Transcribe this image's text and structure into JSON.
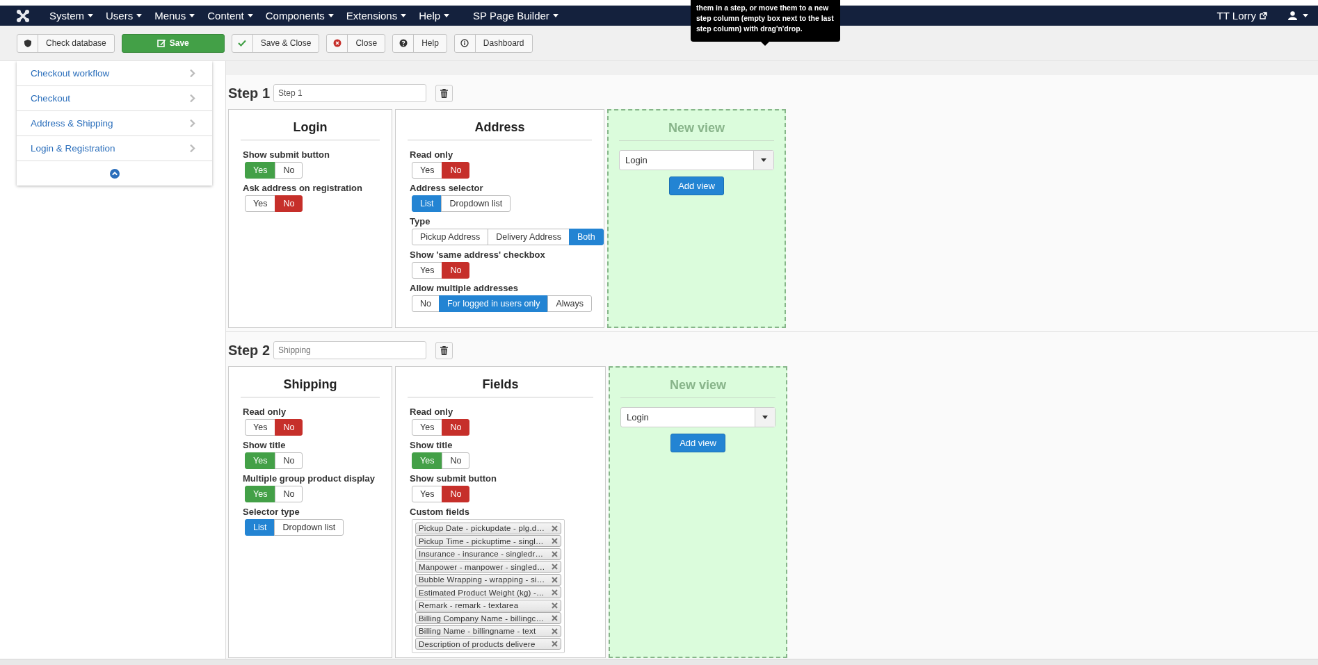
{
  "navbar": {
    "menus": [
      "System",
      "Users",
      "Menus",
      "Content",
      "Components",
      "Extensions",
      "Help",
      "SP Page Builder"
    ],
    "site_link": "TT Lorry"
  },
  "tooltip": {
    "text": "them in a step, or move them to a new step column (empty box next to the last step column) with drag'n'drop."
  },
  "toolbar": {
    "buttons": [
      {
        "label": "Check database",
        "kind": "shield"
      },
      {
        "label": "Save",
        "kind": "save"
      },
      {
        "label": "Save & Close",
        "kind": "check"
      },
      {
        "label": "Close",
        "kind": "close"
      },
      {
        "label": "Help",
        "kind": "help"
      },
      {
        "label": "Dashboard",
        "kind": "info"
      }
    ]
  },
  "sidebar": {
    "items": [
      "Checkout workflow",
      "Checkout",
      "Address & Shipping",
      "Login & Registration"
    ]
  },
  "steps": [
    {
      "title": "Step 1",
      "input": {
        "value": "Step 1"
      },
      "views": [
        {
          "title": "Login",
          "options": [
            {
              "label": "Show submit button",
              "choices": [
                {
                  "label": "Yes",
                  "selected": true,
                  "color": "#43a047"
                },
                {
                  "label": "No",
                  "selected": false
                }
              ]
            },
            {
              "label": "Ask address on registration",
              "choices": [
                {
                  "label": "Yes",
                  "selected": false
                },
                {
                  "label": "No",
                  "selected": true,
                  "color": "#c62f2a"
                }
              ]
            }
          ]
        },
        {
          "title": "Address",
          "options": [
            {
              "label": "Read only",
              "choices": [
                {
                  "label": "Yes",
                  "selected": false
                },
                {
                  "label": "No",
                  "selected": true,
                  "color": "#c62f2a"
                }
              ]
            },
            {
              "label": "Address selector",
              "choices": [
                {
                  "label": "List",
                  "selected": true,
                  "color": "#2384d3"
                },
                {
                  "label": "Dropdown list",
                  "selected": false
                }
              ]
            },
            {
              "label": "Type",
              "choices": [
                {
                  "label": "Pickup Address",
                  "selected": false
                },
                {
                  "label": "Delivery Address",
                  "selected": false
                },
                {
                  "label": "Both",
                  "selected": true,
                  "color": "#2384d3"
                }
              ]
            },
            {
              "label": "Show 'same address' checkbox",
              "choices": [
                {
                  "label": "Yes",
                  "selected": false
                },
                {
                  "label": "No",
                  "selected": true,
                  "color": "#c62f2a"
                }
              ]
            },
            {
              "label": "Allow multiple addresses",
              "choices": [
                {
                  "label": "No",
                  "selected": false
                },
                {
                  "label": "For logged in users only",
                  "selected": true,
                  "color": "#2384d3"
                },
                {
                  "label": "Always",
                  "selected": false
                }
              ]
            }
          ]
        }
      ],
      "new_view": {
        "title": "New view",
        "select": "Login",
        "button": "Add view"
      }
    },
    {
      "title": "Step 2",
      "input": {
        "placeholder": "Shipping"
      },
      "views": [
        {
          "title": "Shipping",
          "options": [
            {
              "label": "Read only",
              "choices": [
                {
                  "label": "Yes",
                  "selected": false
                },
                {
                  "label": "No",
                  "selected": true,
                  "color": "#c62f2a"
                }
              ]
            },
            {
              "label": "Show title",
              "choices": [
                {
                  "label": "Yes",
                  "selected": true,
                  "color": "#43a047"
                },
                {
                  "label": "No",
                  "selected": false
                }
              ]
            },
            {
              "label": "Multiple group product display",
              "choices": [
                {
                  "label": "Yes",
                  "selected": true,
                  "color": "#43a047"
                },
                {
                  "label": "No",
                  "selected": false
                }
              ]
            },
            {
              "label": "Selector type",
              "choices": [
                {
                  "label": "List",
                  "selected": true,
                  "color": "#2384d3"
                },
                {
                  "label": "Dropdown list",
                  "selected": false
                }
              ]
            }
          ]
        },
        {
          "title": "Fields",
          "options": [
            {
              "label": "Read only",
              "choices": [
                {
                  "label": "Yes",
                  "selected": false
                },
                {
                  "label": "No",
                  "selected": true,
                  "color": "#c62f2a"
                }
              ]
            },
            {
              "label": "Show title",
              "choices": [
                {
                  "label": "Yes",
                  "selected": true,
                  "color": "#43a047"
                },
                {
                  "label": "No",
                  "selected": false
                }
              ]
            },
            {
              "label": "Show submit button",
              "choices": [
                {
                  "label": "Yes",
                  "selected": false
                },
                {
                  "label": "No",
                  "selected": true,
                  "color": "#c62f2a"
                }
              ]
            }
          ],
          "custom_fields": {
            "label": "Custom fields",
            "tags": [
              "Pickup Date - pickupdate - plg.d…",
              "Pickup Time - pickuptime - singl…",
              "Insurance - insurance - singledr…",
              "Manpower - manpower - singled…",
              "Bubble Wrapping - wrapping - si…",
              "Estimated Product Weight (kg) -…",
              "Remark - remark - textarea",
              "Billing Company Name - billingc…",
              "Billing Name - billingname - text",
              "Description of products delivere"
            ]
          }
        }
      ],
      "new_view": {
        "title": "New view",
        "select": "Login",
        "button": "Add view"
      }
    }
  ]
}
